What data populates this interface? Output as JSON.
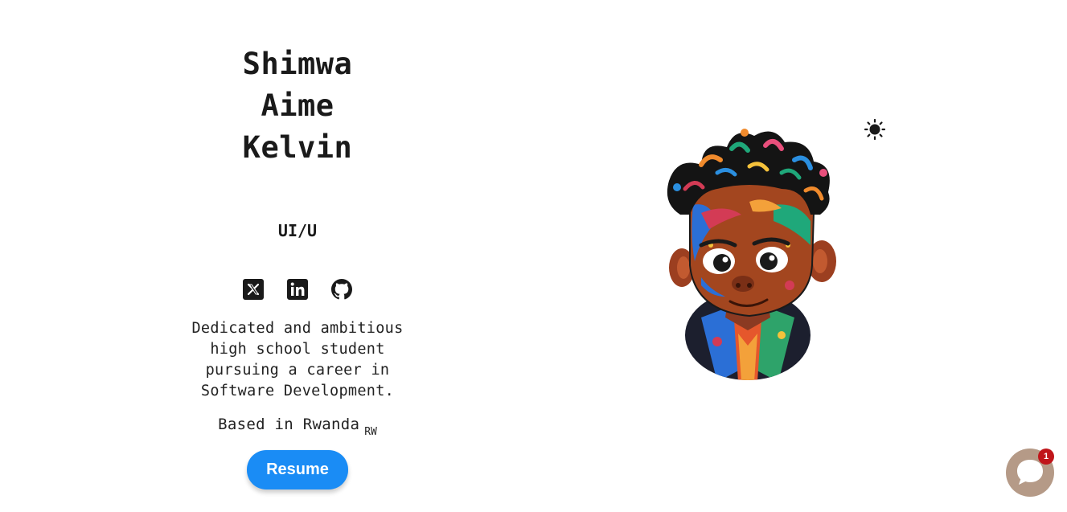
{
  "profile": {
    "name_line_1": "Shimwa",
    "name_line_2": "Aime",
    "name_line_3": "Kelvin",
    "role": "UI/U",
    "bio": "Dedicated and ambitious high school student pursuing a career in Software Development.",
    "location": "Based in Rwanda",
    "flag": "RW",
    "resume_label": "Resume"
  },
  "socials": [
    {
      "icon": "x-twitter-icon"
    },
    {
      "icon": "linkedin-icon"
    },
    {
      "icon": "github-icon"
    }
  ],
  "chat": {
    "badge_count": "1"
  },
  "colors": {
    "accent": "#1a8cf5",
    "chat_bg": "#b59a87",
    "badge": "#c0151a",
    "text": "#1a1a1a"
  }
}
